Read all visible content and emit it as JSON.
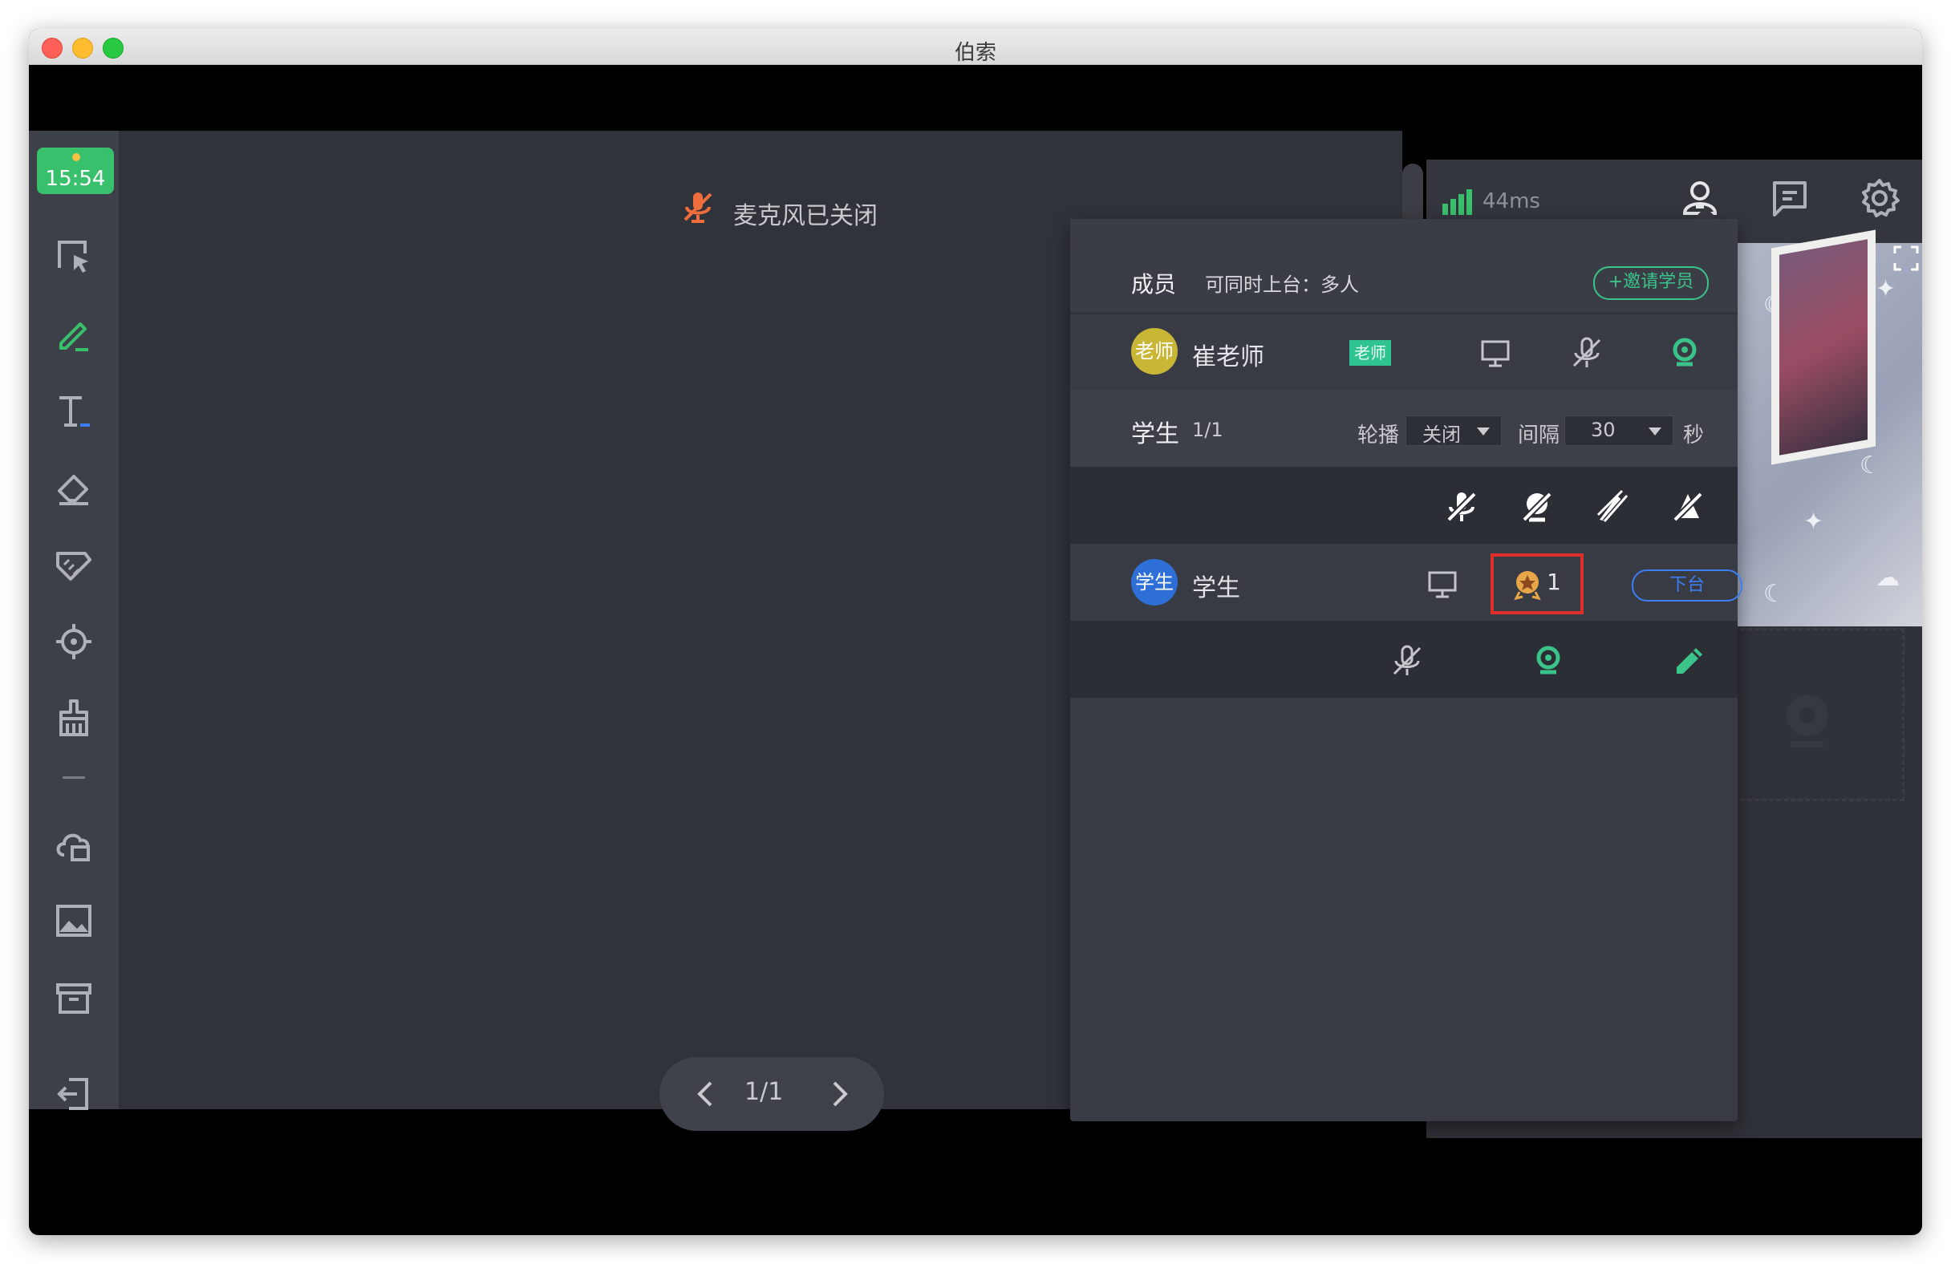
{
  "window": {
    "title": "伯索"
  },
  "toolbar": {
    "clock": "15:54",
    "tools": [
      "select-tool",
      "pen-tool",
      "text-tool",
      "eraser-tool",
      "ruler-tool",
      "laser-pointer-tool",
      "clear-tool",
      "cloud-disk-tool",
      "image-tool",
      "box-tool",
      "exit-tool"
    ]
  },
  "canvas": {
    "mic_status": "麦克风已关闭",
    "page_indicator": "1/1"
  },
  "status": {
    "latency": "44ms"
  },
  "panel": {
    "title": "成员",
    "stage_mode": "可同时上台：多人",
    "invite_button": "+邀请学员",
    "teacher": {
      "avatar_text": "老师",
      "name": "崔老师",
      "badge": "老师"
    },
    "students_header": {
      "label": "学生",
      "count": "1/1",
      "carousel_label": "轮播",
      "carousel_value": "关闭",
      "interval_label": "间隔",
      "interval_value": "30",
      "unit": "秒"
    },
    "student": {
      "avatar_text": "学生",
      "name": "学生",
      "reward_count": "1",
      "offstage_button": "下台"
    }
  },
  "colors": {
    "accent_green": "#3bc48a",
    "offstage_blue": "#3e7ef5",
    "highlight_red": "#e02f2b",
    "mic_off_orange": "#f06d3c",
    "teacher_avatar": "#c9b637",
    "student_avatar": "#2d6fd6"
  }
}
